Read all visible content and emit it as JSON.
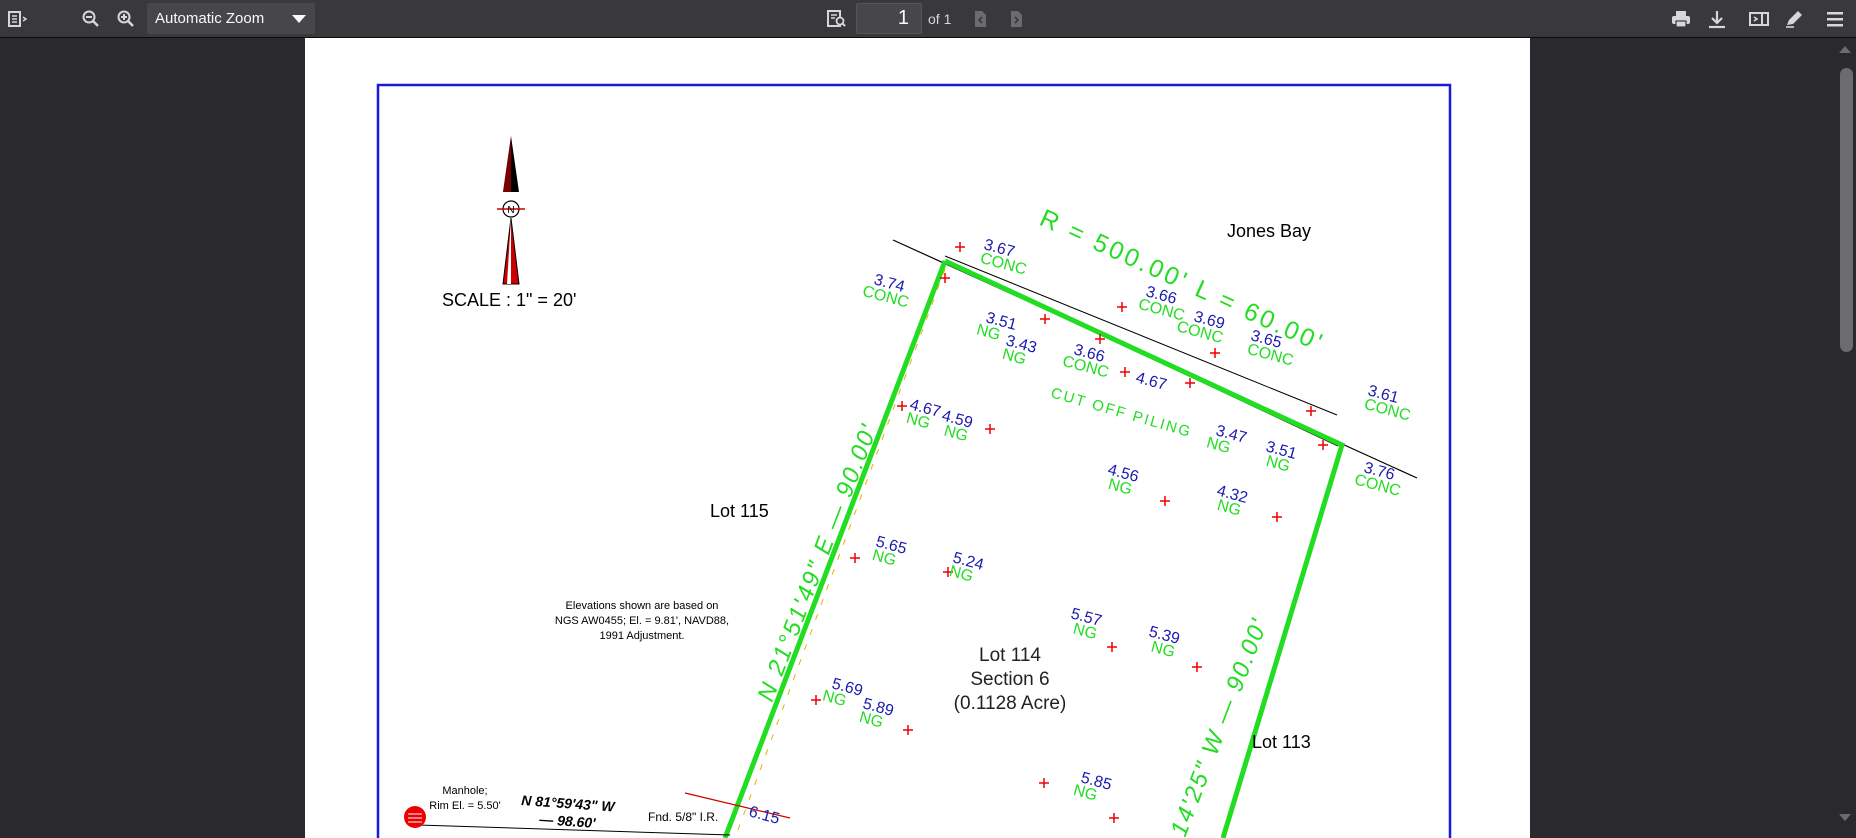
{
  "toolbar": {
    "zoom_label": "Automatic Zoom",
    "page_number": "1",
    "page_count_label": "of 1",
    "icons": [
      "sidebar-toggle-icon",
      "zoom-out-icon",
      "zoom-in-icon",
      "find-icon",
      "previous-page-icon",
      "next-page-icon",
      "print-icon",
      "download-icon",
      "presentation-mode-icon",
      "annotation-edit-icon",
      "tools-menu-icon"
    ]
  },
  "document": {
    "jones_bay": "Jones Bay",
    "scale": "SCALE : 1\" = 20'",
    "north": "N",
    "curve_label": "R = 500.00' L = 60.00'",
    "west_bearing": "N 21°51'49\" E — 90.00'",
    "east_bearing": "14'25\" W — 90.00'",
    "lot115": "Lot 115",
    "lot113": "Lot 113",
    "lot114": [
      "Lot 114",
      "Section 6",
      "(0.1128 Acre)"
    ],
    "note": [
      "Elevations shown are based on",
      "NGS AW0455; El. = 9.81', NAVD88,",
      "1991 Adjustment."
    ],
    "manhole": [
      "Manhole;",
      "Rim El. = 5.50'"
    ],
    "south_bearing": [
      "N 81°59'43\" W",
      "— 98.60'"
    ],
    "iron_rod": "Fnd. 5/8\" I.R.",
    "cut_off_piling": "CUT OFF PILING",
    "spots": [
      {
        "v": "3.67",
        "t": "CONC"
      },
      {
        "v": "3.74",
        "t": "CONC"
      },
      {
        "v": "3.66",
        "t": "CONC"
      },
      {
        "v": "3.69",
        "t": "CONC"
      },
      {
        "v": "3.65",
        "t": "CONC"
      },
      {
        "v": "3.61",
        "t": "CONC"
      },
      {
        "v": "3.51",
        "t": "NG"
      },
      {
        "v": "3.43",
        "t": "NG"
      },
      {
        "v": "3.66",
        "t": "CONC"
      },
      {
        "v": "4.67",
        "t": ""
      },
      {
        "v": "4.67",
        "t": "NG"
      },
      {
        "v": "4.59",
        "t": "NG"
      },
      {
        "v": "3.47",
        "t": "NG"
      },
      {
        "v": "3.51",
        "t": "NG"
      },
      {
        "v": "3.76",
        "t": "CONC"
      },
      {
        "v": "4.56",
        "t": "NG"
      },
      {
        "v": "4.32",
        "t": "NG"
      },
      {
        "v": "5.65",
        "t": "NG"
      },
      {
        "v": "5.24",
        "t": "NG"
      },
      {
        "v": "5.57",
        "t": "NG"
      },
      {
        "v": "5.39",
        "t": "NG"
      },
      {
        "v": "5.69",
        "t": "NG"
      },
      {
        "v": "5.89",
        "t": "NG"
      },
      {
        "v": "5.85",
        "t": "NG"
      },
      {
        "v": "6.15",
        "t": ""
      }
    ]
  }
}
